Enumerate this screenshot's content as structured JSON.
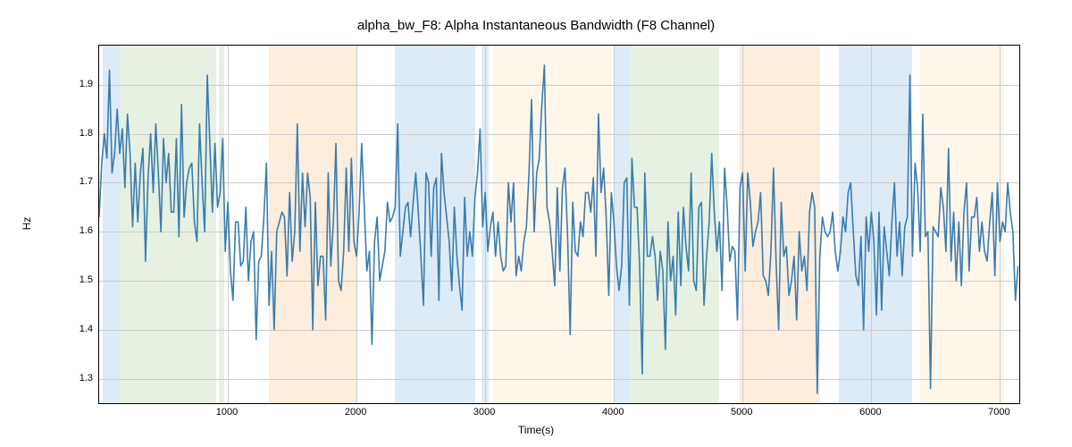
{
  "chart_data": {
    "type": "line",
    "title": "alpha_bw_F8: Alpha Instantaneous Bandwidth (F8 Channel)",
    "xlabel": "Time(s)",
    "ylabel": "Hz",
    "xlim": [
      0,
      7150
    ],
    "ylim": [
      1.25,
      1.98
    ],
    "xticks": [
      1000,
      2000,
      3000,
      4000,
      5000,
      6000,
      7000
    ],
    "yticks": [
      1.3,
      1.4,
      1.5,
      1.6,
      1.7,
      1.8,
      1.9
    ],
    "bands": [
      {
        "x0": 30,
        "x1": 170,
        "color": "blue"
      },
      {
        "x0": 170,
        "x1": 910,
        "color": "green"
      },
      {
        "x0": 930,
        "x1": 970,
        "color": "green"
      },
      {
        "x0": 1320,
        "x1": 2000,
        "color": "orange"
      },
      {
        "x0": 2300,
        "x1": 2920,
        "color": "blue"
      },
      {
        "x0": 2970,
        "x1": 3030,
        "color": "blue"
      },
      {
        "x0": 3060,
        "x1": 3980,
        "color": "bisque"
      },
      {
        "x0": 4000,
        "x1": 4120,
        "color": "blue"
      },
      {
        "x0": 4120,
        "x1": 4820,
        "color": "green"
      },
      {
        "x0": 4980,
        "x1": 5600,
        "color": "orange"
      },
      {
        "x0": 5750,
        "x1": 6320,
        "color": "blue"
      },
      {
        "x0": 6380,
        "x1": 7030,
        "color": "bisque"
      }
    ],
    "x": [
      0,
      20,
      40,
      60,
      80,
      100,
      120,
      140,
      160,
      180,
      200,
      220,
      240,
      260,
      280,
      300,
      320,
      340,
      360,
      380,
      400,
      420,
      440,
      460,
      480,
      500,
      520,
      540,
      560,
      580,
      600,
      620,
      640,
      660,
      680,
      700,
      720,
      740,
      760,
      780,
      800,
      820,
      840,
      860,
      880,
      900,
      920,
      940,
      960,
      980,
      1000,
      1020,
      1040,
      1060,
      1080,
      1100,
      1120,
      1140,
      1160,
      1180,
      1200,
      1220,
      1240,
      1260,
      1280,
      1300,
      1320,
      1340,
      1360,
      1380,
      1400,
      1420,
      1440,
      1460,
      1480,
      1500,
      1520,
      1540,
      1560,
      1580,
      1600,
      1620,
      1640,
      1660,
      1680,
      1700,
      1720,
      1740,
      1760,
      1780,
      1800,
      1820,
      1840,
      1860,
      1880,
      1900,
      1920,
      1940,
      1960,
      1980,
      2000,
      2020,
      2040,
      2060,
      2080,
      2100,
      2120,
      2140,
      2160,
      2180,
      2200,
      2220,
      2240,
      2260,
      2280,
      2300,
      2320,
      2340,
      2360,
      2380,
      2400,
      2420,
      2440,
      2460,
      2480,
      2500,
      2520,
      2540,
      2560,
      2580,
      2600,
      2620,
      2640,
      2660,
      2680,
      2700,
      2720,
      2740,
      2760,
      2780,
      2800,
      2820,
      2840,
      2860,
      2880,
      2900,
      2920,
      2940,
      2960,
      2980,
      3000,
      3020,
      3040,
      3060,
      3080,
      3100,
      3120,
      3140,
      3160,
      3180,
      3200,
      3220,
      3240,
      3260,
      3280,
      3300,
      3320,
      3340,
      3360,
      3380,
      3400,
      3420,
      3440,
      3460,
      3480,
      3500,
      3520,
      3540,
      3560,
      3580,
      3600,
      3620,
      3640,
      3660,
      3680,
      3700,
      3720,
      3740,
      3760,
      3780,
      3800,
      3820,
      3840,
      3860,
      3880,
      3900,
      3920,
      3940,
      3960,
      3980,
      4000,
      4020,
      4040,
      4060,
      4080,
      4100,
      4120,
      4140,
      4160,
      4180,
      4200,
      4220,
      4240,
      4260,
      4280,
      4300,
      4320,
      4340,
      4360,
      4380,
      4400,
      4420,
      4440,
      4460,
      4480,
      4500,
      4520,
      4540,
      4560,
      4580,
      4600,
      4620,
      4640,
      4660,
      4680,
      4700,
      4720,
      4740,
      4760,
      4780,
      4800,
      4820,
      4840,
      4860,
      4880,
      4900,
      4920,
      4940,
      4960,
      4980,
      5000,
      5020,
      5040,
      5060,
      5080,
      5100,
      5120,
      5140,
      5160,
      5180,
      5200,
      5220,
      5240,
      5260,
      5280,
      5300,
      5320,
      5340,
      5360,
      5380,
      5400,
      5420,
      5440,
      5460,
      5480,
      5500,
      5520,
      5540,
      5560,
      5580,
      5600,
      5620,
      5640,
      5660,
      5680,
      5700,
      5720,
      5740,
      5760,
      5780,
      5800,
      5820,
      5840,
      5860,
      5880,
      5900,
      5920,
      5940,
      5960,
      5980,
      6000,
      6020,
      6040,
      6060,
      6080,
      6100,
      6120,
      6140,
      6160,
      6180,
      6200,
      6220,
      6240,
      6260,
      6280,
      6300,
      6320,
      6340,
      6360,
      6380,
      6400,
      6420,
      6440,
      6460,
      6480,
      6500,
      6520,
      6540,
      6560,
      6580,
      6600,
      6620,
      6640,
      6660,
      6680,
      6700,
      6720,
      6740,
      6760,
      6780,
      6800,
      6820,
      6840,
      6860,
      6880,
      6900,
      6920,
      6940,
      6960,
      6980,
      7000,
      7020,
      7040,
      7060,
      7080,
      7100,
      7120,
      7140
    ],
    "values": [
      1.63,
      1.74,
      1.8,
      1.75,
      1.93,
      1.72,
      1.76,
      1.85,
      1.76,
      1.81,
      1.69,
      1.84,
      1.76,
      1.61,
      1.74,
      1.62,
      1.72,
      1.77,
      1.54,
      1.71,
      1.8,
      1.68,
      1.82,
      1.72,
      1.6,
      1.79,
      1.7,
      1.76,
      1.64,
      1.64,
      1.79,
      1.59,
      1.86,
      1.63,
      1.7,
      1.73,
      1.74,
      1.62,
      1.58,
      1.82,
      1.7,
      1.6,
      1.92,
      1.78,
      1.64,
      1.78,
      1.65,
      1.68,
      1.79,
      1.56,
      1.66,
      1.52,
      1.46,
      1.62,
      1.62,
      1.53,
      1.54,
      1.65,
      1.5,
      1.58,
      1.6,
      1.38,
      1.54,
      1.55,
      1.63,
      1.74,
      1.45,
      1.56,
      1.4,
      1.6,
      1.62,
      1.64,
      1.63,
      1.51,
      1.68,
      1.54,
      1.6,
      1.82,
      1.56,
      1.72,
      1.61,
      1.72,
      1.67,
      1.4,
      1.66,
      1.49,
      1.55,
      1.55,
      1.42,
      1.72,
      1.53,
      1.62,
      1.78,
      1.5,
      1.48,
      1.56,
      1.73,
      1.56,
      1.75,
      1.58,
      1.55,
      1.64,
      1.78,
      1.65,
      1.52,
      1.56,
      1.37,
      1.58,
      1.63,
      1.5,
      1.53,
      1.56,
      1.66,
      1.62,
      1.63,
      1.65,
      1.82,
      1.55,
      1.6,
      1.65,
      1.66,
      1.59,
      1.66,
      1.72,
      1.64,
      1.55,
      1.45,
      1.72,
      1.7,
      1.55,
      1.69,
      1.71,
      1.46,
      1.76,
      1.68,
      1.63,
      1.58,
      1.48,
      1.65,
      1.55,
      1.49,
      1.44,
      1.67,
      1.55,
      1.6,
      1.55,
      1.67,
      1.72,
      1.81,
      1.61,
      1.68,
      1.56,
      1.61,
      1.64,
      1.55,
      1.62,
      1.55,
      1.52,
      1.53,
      1.7,
      1.62,
      1.7,
      1.51,
      1.55,
      1.52,
      1.58,
      1.61,
      1.72,
      1.87,
      1.6,
      1.72,
      1.75,
      1.86,
      1.94,
      1.65,
      1.62,
      1.56,
      1.49,
      1.69,
      1.52,
      1.69,
      1.73,
      1.59,
      1.39,
      1.66,
      1.56,
      1.55,
      1.62,
      1.59,
      1.68,
      1.68,
      1.64,
      1.71,
      1.55,
      1.84,
      1.68,
      1.73,
      1.63,
      1.47,
      1.68,
      1.62,
      1.53,
      1.48,
      1.53,
      1.7,
      1.71,
      1.45,
      1.75,
      1.65,
      1.65,
      1.53,
      1.31,
      1.72,
      1.55,
      1.55,
      1.59,
      1.55,
      1.46,
      1.56,
      1.52,
      1.36,
      1.62,
      1.5,
      1.55,
      1.43,
      1.64,
      1.49,
      1.65,
      1.57,
      1.52,
      1.72,
      1.5,
      1.48,
      1.65,
      1.66,
      1.45,
      1.55,
      1.62,
      1.76,
      1.64,
      1.56,
      1.62,
      1.48,
      1.73,
      1.65,
      1.54,
      1.57,
      1.56,
      1.42,
      1.69,
      1.72,
      1.52,
      1.72,
      1.66,
      1.57,
      1.6,
      1.62,
      1.68,
      1.51,
      1.5,
      1.47,
      1.56,
      1.73,
      1.54,
      1.4,
      1.66,
      1.55,
      1.57,
      1.47,
      1.5,
      1.55,
      1.42,
      1.6,
      1.52,
      1.55,
      1.48,
      1.64,
      1.68,
      1.65,
      1.27,
      1.55,
      1.63,
      1.6,
      1.59,
      1.6,
      1.64,
      1.56,
      1.52,
      1.56,
      1.63,
      1.6,
      1.68,
      1.7,
      1.6,
      1.51,
      1.49,
      1.59,
      1.4,
      1.63,
      1.56,
      1.64,
      1.58,
      1.43,
      1.64,
      1.44,
      1.61,
      1.56,
      1.51,
      1.62,
      1.7,
      1.55,
      1.62,
      1.51,
      1.61,
      1.63,
      1.92,
      1.55,
      1.74,
      1.69,
      1.56,
      1.84,
      1.59,
      1.6,
      1.28,
      1.61,
      1.6,
      1.59,
      1.69,
      1.65,
      1.56,
      1.77,
      1.54,
      1.64,
      1.5,
      1.62,
      1.49,
      1.64,
      1.7,
      1.52,
      1.63,
      1.63,
      1.67,
      1.56,
      1.62,
      1.56,
      1.54,
      1.62,
      1.68,
      1.51,
      1.7,
      1.58,
      1.62,
      1.6,
      1.7,
      1.64,
      1.6,
      1.46,
      1.53
    ]
  }
}
